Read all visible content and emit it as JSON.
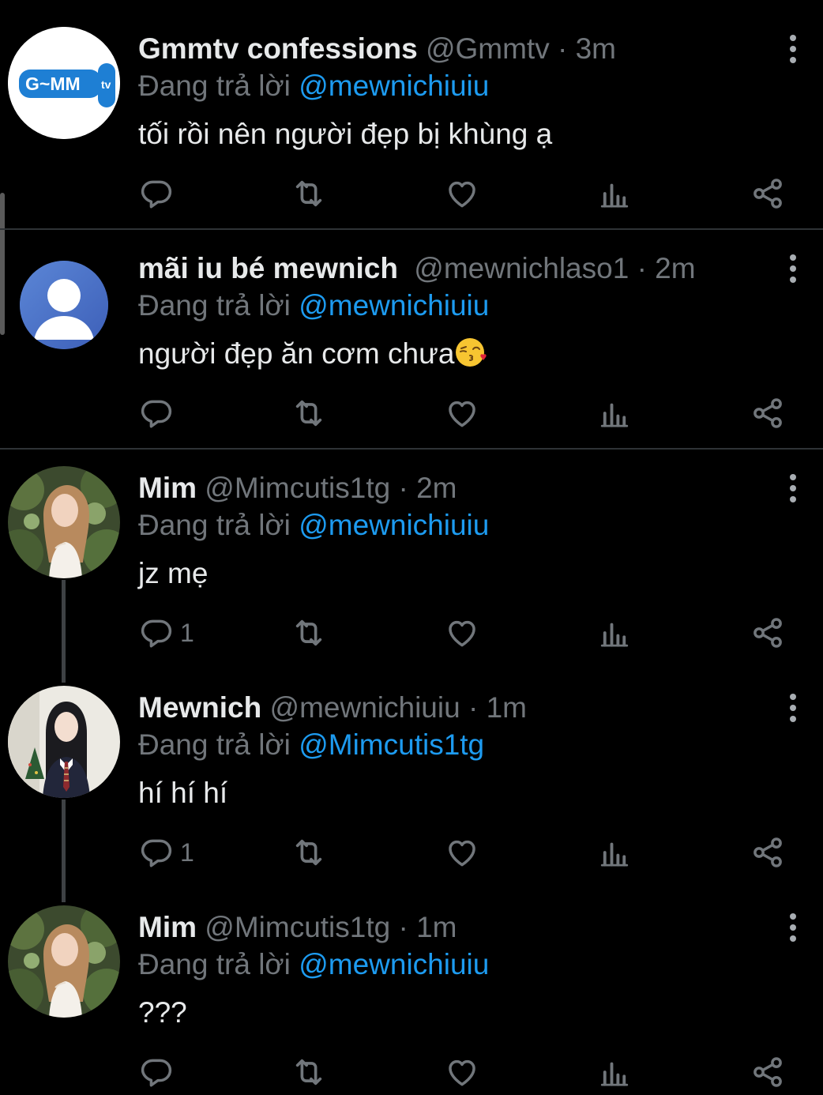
{
  "colors": {
    "background": "#000000",
    "text_primary": "#e7e9ea",
    "text_secondary": "#71767b",
    "accent": "#1d9bf0",
    "divider": "#2f3336",
    "thread_line": "#3e4144"
  },
  "icons": {
    "reply": "reply-icon",
    "retweet": "retweet-icon",
    "like": "heart-icon",
    "views": "bar-chart-icon",
    "share": "share-icon",
    "more": "more-vertical-icon"
  },
  "tweets": [
    {
      "name": "Gmmtv confessions",
      "handle": "@Gmmtv",
      "sep": "·",
      "time": "3m",
      "replying_prefix": "Đang trả lời",
      "replying_to": "@mewnichiuiu",
      "text": "tối rồi nên người đẹp bị khùng ạ",
      "reply_count": "",
      "avatar": "gmmtv-logo",
      "avatar_logo_text": "G~MM",
      "avatar_logo_badge": "tv"
    },
    {
      "name": "mãi iu bé mewnich",
      "handle": "@mewnichlaso1",
      "sep": "·",
      "time": "2m",
      "replying_prefix": "Đang trả lời",
      "replying_to": "@mewnichiuiu",
      "text": "người đẹp ăn cơm chưa",
      "emoji": "kissing-face-emoji",
      "reply_count": "",
      "avatar": "default-avatar"
    },
    {
      "name": "Mim",
      "handle": "@Mimcutis1tg",
      "sep": "·",
      "time": "2m",
      "replying_prefix": "Đang trả lời",
      "replying_to": "@mewnichiuiu",
      "text": "jz mẹ",
      "reply_count": "1",
      "avatar": "photo-avatar-girl-garden"
    },
    {
      "name": "Mewnich",
      "handle": "@mewnichiuiu",
      "sep": "·",
      "time": "1m",
      "replying_prefix": "Đang trả lời",
      "replying_to": "@Mimcutis1tg",
      "text": "hí hí hí",
      "reply_count": "1",
      "avatar": "photo-avatar-girl-uniform"
    },
    {
      "name": "Mim",
      "handle": "@Mimcutis1tg",
      "sep": "·",
      "time": "1m",
      "replying_prefix": "Đang trả lời",
      "replying_to": "@mewnichiuiu",
      "text": "???",
      "reply_count": "",
      "avatar": "photo-avatar-girl-garden"
    }
  ]
}
